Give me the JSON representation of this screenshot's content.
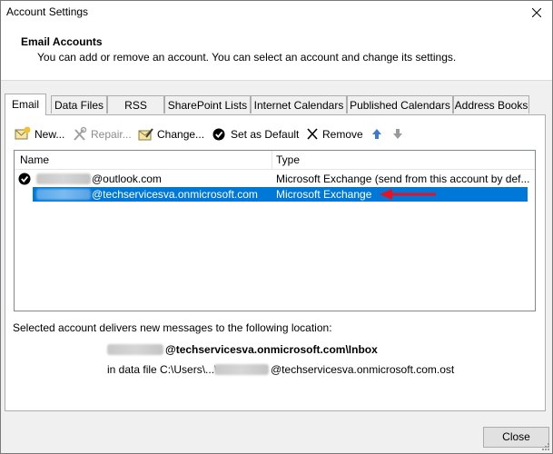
{
  "window": {
    "title": "Account Settings",
    "close_glyph": "×"
  },
  "header": {
    "title": "Email Accounts",
    "description": "You can add or remove an account. You can select an account and change its settings."
  },
  "tabs": [
    {
      "label": "Email",
      "active": true
    },
    {
      "label": "Data Files"
    },
    {
      "label": "RSS Feeds"
    },
    {
      "label": "SharePoint Lists"
    },
    {
      "label": "Internet Calendars"
    },
    {
      "label": "Published Calendars"
    },
    {
      "label": "Address Books"
    }
  ],
  "toolbar": {
    "new_label": "New...",
    "repair_label": "Repair...",
    "change_label": "Change...",
    "set_default_label": "Set as Default",
    "remove_label": "Remove",
    "icons": [
      "new-mail-icon",
      "repair-tools-icon",
      "change-icon",
      "checkmark-icon",
      "remove-x-icon",
      "arrow-up-icon",
      "arrow-down-icon"
    ]
  },
  "accounts_list": {
    "columns": [
      "Name",
      "Type"
    ],
    "rows": [
      {
        "name": "@outlook.com",
        "type": "Microsoft Exchange (send from this account by def...",
        "default": true,
        "selected": false
      },
      {
        "name": "@techservicesva.onmicrosoft.com",
        "type": "Microsoft Exchange",
        "default": false,
        "selected": true
      }
    ]
  },
  "delivery": {
    "label": "Selected account delivers new messages to the following location:",
    "folder": "@techservicesva.onmicrosoft.com\\Inbox",
    "file_prefix": "in data file C:\\Users\\...\\",
    "file_suffix": "@techservicesva.onmicrosoft.com.ost"
  },
  "footer": {
    "close_label": "Close"
  },
  "colors": {
    "selection": "#0078d7",
    "annotation_arrow": "#e81123",
    "arrow_icon": "#3b78d8"
  }
}
